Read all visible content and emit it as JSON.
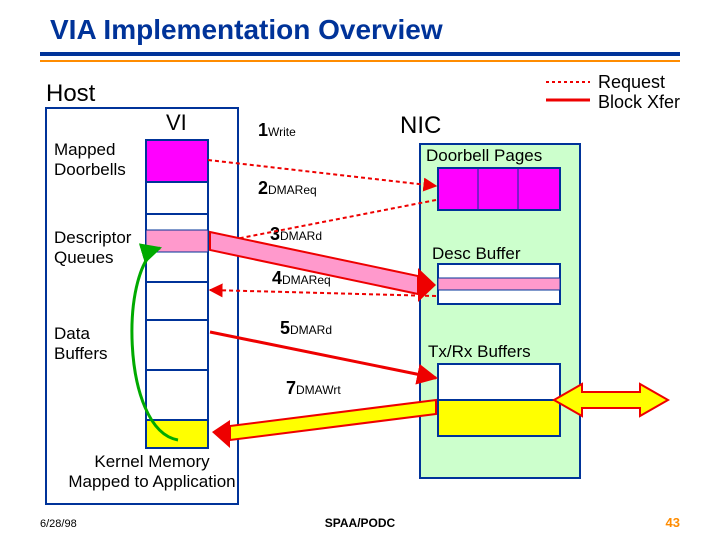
{
  "title": "VIA Implementation Overview",
  "host_label": "Host",
  "vi_label": "VI",
  "nic_label": "NIC",
  "legend": {
    "request": "Request",
    "block": "Block Xfer"
  },
  "host_items": {
    "mapped": "Mapped\nDoorbells",
    "desc": "Descriptor\nQueues",
    "data": "Data\nBuffers",
    "kernel": "Kernel Memory\nMapped to Application"
  },
  "nic_items": {
    "doorbell": "Doorbell Pages",
    "descbuf": "Desc Buffer",
    "txrx": "Tx/Rx Buffers"
  },
  "steps": {
    "s1n": "1",
    "s1": "Write",
    "s2n": "2",
    "s2": "DMAReq",
    "s3n": "3",
    "s3": "DMARd",
    "s4n": "4",
    "s4": "DMAReq",
    "s5n": "5",
    "s5": "DMARd",
    "s7n": "7",
    "s7": "DMAWrt"
  },
  "footer": {
    "date": "6/28/98",
    "venue": "SPAA/PODC",
    "page": "43"
  }
}
